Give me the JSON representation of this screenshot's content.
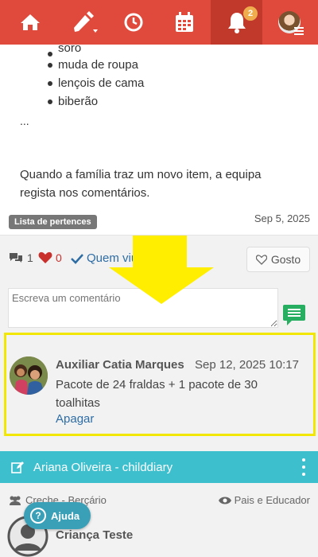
{
  "topbar": {
    "notification_count": "2",
    "items": [
      "home-icon",
      "pencil-icon",
      "clock-icon",
      "calendar-icon",
      "bell-icon",
      "user-avatar"
    ]
  },
  "post": {
    "list_items": [
      "soro",
      "muda de roupa",
      "lençois de cama",
      "biberão"
    ],
    "ellipsis": "...",
    "text": "Quando a família traz um novo item, a equipa regista nos comentários.",
    "tag": "Lista de pertences",
    "date": "Sep 5, 2025"
  },
  "actions": {
    "comment_count": "1",
    "like_count": "0",
    "seen_label": "Quem viu",
    "like_button": "Gosto"
  },
  "comment_form": {
    "placeholder": "Escreva um comentário"
  },
  "comment": {
    "author": "Auxiliar Catia Marques",
    "date": "Sep 12, 2025 10:17",
    "text": "Pacote de 24 fraldas + 1 pacote de 30 toalhitas",
    "delete_label": "Apagar"
  },
  "diary": {
    "title": "Ariana Oliveira - childdiary",
    "group": "Creche - Berçário",
    "visibility": "Pais e Educador",
    "child_name": "Criança Teste"
  },
  "help": {
    "label": "Ajuda"
  },
  "colors": {
    "topbar": "#e04a3c",
    "diary_bar": "#3dbfce",
    "highlight": "#f2e700",
    "link": "#2e6da4"
  }
}
